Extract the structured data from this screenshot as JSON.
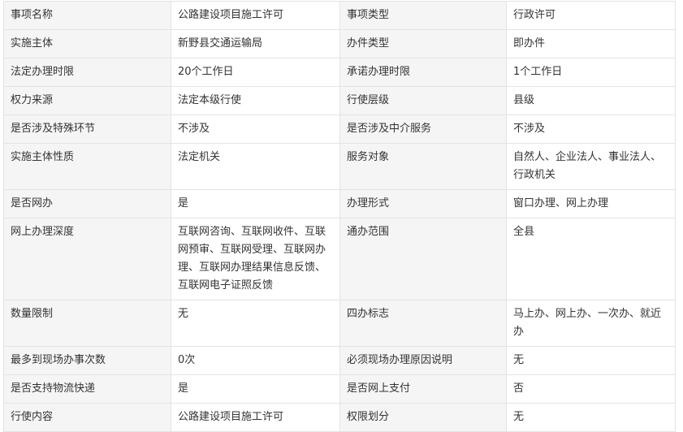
{
  "rows": [
    {
      "l1": "事项名称",
      "v1": "公路建设项目施工许可",
      "l2": "事项类型",
      "v2": "行政许可"
    },
    {
      "l1": "实施主体",
      "v1": "新野县交通运输局",
      "l2": "办件类型",
      "v2": "即办件"
    },
    {
      "l1": "法定办理时限",
      "v1": "20个工作日",
      "l2": "承诺办理时限",
      "v2": "1个工作日"
    },
    {
      "l1": "权力来源",
      "v1": "法定本级行使",
      "l2": "行使层级",
      "v2": "县级"
    },
    {
      "l1": "是否涉及特殊环节",
      "v1": "不涉及",
      "l2": "是否涉及中介服务",
      "v2": "不涉及"
    },
    {
      "l1": "实施主体性质",
      "v1": "法定机关",
      "l2": "服务对象",
      "v2": "自然人、企业法人、事业法人、行政机关"
    },
    {
      "l1": "是否网办",
      "v1": "是",
      "l2": "办理形式",
      "v2": "窗口办理、网上办理"
    },
    {
      "l1": "网上办理深度",
      "v1": "互联网咨询、互联网收件、互联网预审、互联网受理、互联网办理、互联网办理结果信息反馈、互联网电子证照反馈",
      "l2": "通办范围",
      "v2": "全县"
    },
    {
      "l1": "数量限制",
      "v1": "无",
      "l2": "四办标志",
      "v2": "马上办、网上办、一次办、就近办"
    },
    {
      "l1": "最多到现场办事次数",
      "v1": "0次",
      "l2": "必须现场办理原因说明",
      "v2": "无"
    },
    {
      "l1": "是否支持物流快递",
      "v1": "是",
      "l2": "是否网上支付",
      "v2": "否"
    },
    {
      "l1": "行使内容",
      "v1": "公路建设项目施工许可",
      "l2": "权限划分",
      "v2": "无"
    }
  ]
}
